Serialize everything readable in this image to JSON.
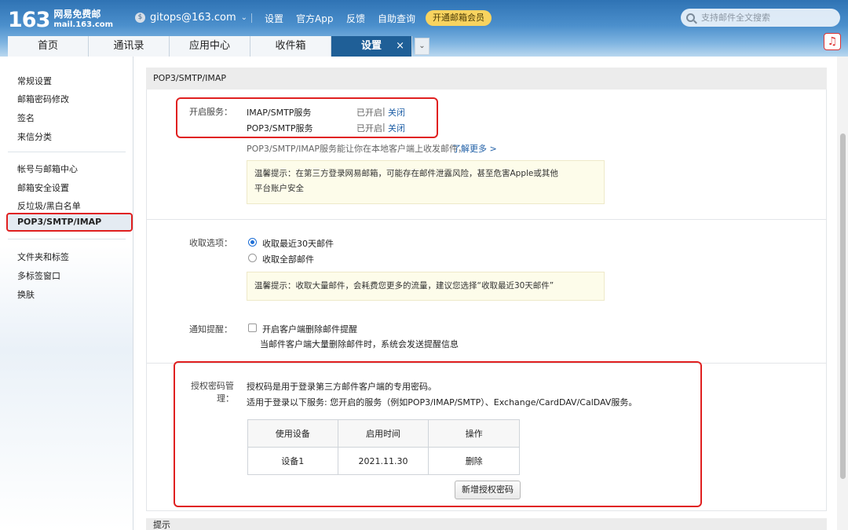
{
  "header": {
    "logo_number": "163",
    "logo_line1": "网易免费邮",
    "logo_line2": "mail.163.com",
    "account": "gitops@163.com",
    "links": [
      "设置",
      "官方App",
      "反馈",
      "自助查询"
    ],
    "vip_button": "开通邮箱会员",
    "search_placeholder": "支持邮件全文搜索"
  },
  "tabs": [
    {
      "label": "首页"
    },
    {
      "label": "通讯录"
    },
    {
      "label": "应用中心"
    },
    {
      "label": "收件箱"
    },
    {
      "label": "设置",
      "active": true
    }
  ],
  "tab_close": "×",
  "sidebar": {
    "group1": [
      "常规设置",
      "邮箱密码修改",
      "签名",
      "来信分类"
    ],
    "group2": [
      "帐号与邮箱中心",
      "邮箱安全设置",
      "反垃圾/黑白名单",
      "POP3/SMTP/IMAP"
    ],
    "group3": [
      "文件夹和标签",
      "多标签窗口",
      "换肤"
    ],
    "active": "POP3/SMTP/IMAP"
  },
  "section": {
    "title": "POP3/SMTP/IMAP",
    "services_label": "开启服务：",
    "services": [
      {
        "name": "IMAP/SMTP服务",
        "status": "已开启",
        "sep": "|",
        "action": "关闭"
      },
      {
        "name": "POP3/SMTP服务",
        "status": "已开启",
        "sep": "|",
        "action": "关闭"
      }
    ],
    "desc": "POP3/SMTP/IMAP服务能让你在本地客户端上收发邮件，",
    "learn_more": "了解更多 >",
    "tip1_line1": "温馨提示：在第三方登录网易邮箱，可能存在邮件泄露风险，甚至危害Apple或其他",
    "tip1_line2": "平台账户安全",
    "fetch_label": "收取选项：",
    "fetch_options": [
      "收取最近30天邮件",
      "收取全部邮件"
    ],
    "fetch_selected": 0,
    "tip2": "温馨提示：收取大量邮件，会耗费您更多的流量，建议您选择“收取最近30天邮件”",
    "notify_label": "通知提醒：",
    "notify_option": "开启客户端删除邮件提醒",
    "notify_desc": "当邮件客户端大量删除邮件时，系统会发送提醒信息",
    "auth_label": "授权密码管理：",
    "auth_desc1": "授权码是用于登录第三方邮件客户端的专用密码。",
    "auth_desc2": "适用于登录以下服务: 您开启的服务（例如POP3/IMAP/SMTP）、Exchange/CardDAV/CalDAV服务。",
    "table": {
      "headers": [
        "使用设备",
        "启用时间",
        "操作"
      ],
      "rows": [
        [
          "设备1",
          "2021.11.30",
          "删除"
        ]
      ]
    },
    "add_button": "新增授权密码",
    "next_section": "提示"
  },
  "colors": {
    "accent": "#1f5f97",
    "highlight": "#e02020",
    "link": "#1f5fa6",
    "vip": "#f8d35f"
  }
}
